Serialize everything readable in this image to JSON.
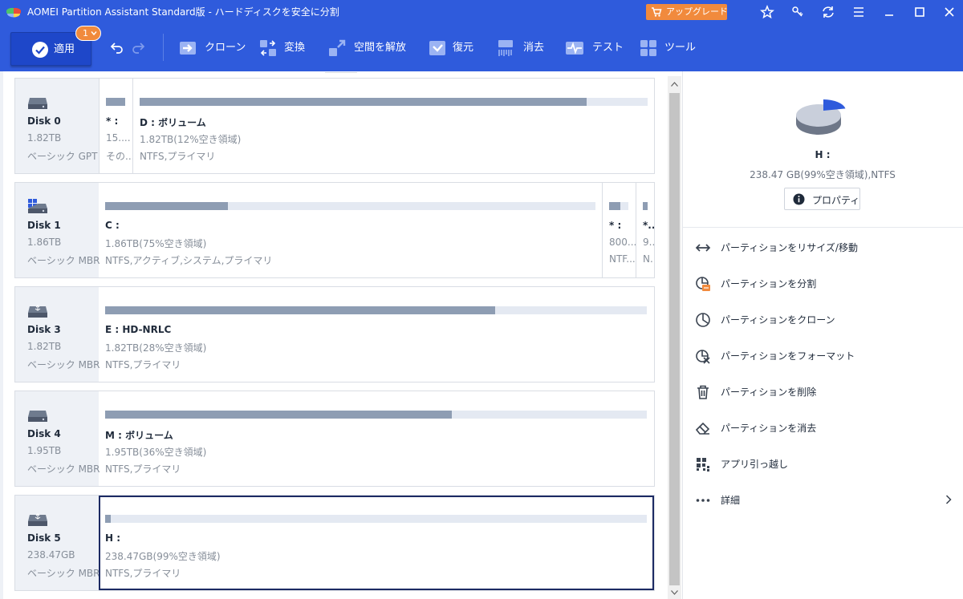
{
  "app": {
    "title": "AOMEI Partition Assistant Standard版 - ハードディスクを安全に分割",
    "upgrade_label": "アップグレード"
  },
  "titlebar_icons": [
    "star-icon",
    "key-icon",
    "refresh-icon",
    "menu-icon",
    "minimize-icon",
    "maximize-icon",
    "close-icon"
  ],
  "toolbar": {
    "apply_label": "適用",
    "pending_count": "1",
    "tools": [
      {
        "label": "クローン",
        "icon": "clone-icon"
      },
      {
        "label": "変換",
        "icon": "convert-icon"
      },
      {
        "label": "空間を解放",
        "icon": "free-space-icon"
      },
      {
        "label": "復元",
        "icon": "recovery-icon"
      },
      {
        "label": "消去",
        "icon": "wipe-icon"
      },
      {
        "label": "テスト",
        "icon": "test-icon"
      },
      {
        "label": "ツール",
        "icon": "tools-icon"
      }
    ]
  },
  "disks": [
    {
      "name": "Disk 0",
      "size": "1.82TB",
      "type": "ベーシック GPT",
      "icon": "hdd-icon",
      "partitions": [
        {
          "name": "* :",
          "size": "15....",
          "fs": "その...",
          "used_fraction": 1.0
        },
        {
          "name": "D : ボリューム",
          "size": "1.82TB(12%空き領域)",
          "fs": "NTFS,プライマリ",
          "used_fraction": 0.88
        }
      ]
    },
    {
      "name": "Disk 1",
      "size": "1.86TB",
      "type": "ベーシック MBR",
      "icon": "windows-disk-icon",
      "partitions": [
        {
          "name": "C :",
          "size": "1.86TB(75%空き領域)",
          "fs": "NTFS,アクティブ,システム,プライマリ",
          "used_fraction": 0.25
        },
        {
          "name": "* :",
          "size": "800...",
          "fs": "NTF...",
          "used_fraction": 0.6
        },
        {
          "name": "*...",
          "size": "9...",
          "fs": "N...",
          "used_fraction": 1.0
        }
      ]
    },
    {
      "name": "Disk 3",
      "size": "1.82TB",
      "type": "ベーシック MBR",
      "icon": "usb-disk-icon",
      "partitions": [
        {
          "name": "E : HD-NRLC",
          "size": "1.82TB(28%空き領域)",
          "fs": "NTFS,プライマリ",
          "used_fraction": 0.72
        }
      ]
    },
    {
      "name": "Disk 4",
      "size": "1.95TB",
      "type": "ベーシック MBR",
      "icon": "hdd-icon",
      "partitions": [
        {
          "name": "M : ボリューム",
          "size": "1.95TB(36%空き領域)",
          "fs": "NTFS,プライマリ",
          "used_fraction": 0.64
        }
      ]
    },
    {
      "name": "Disk 5",
      "size": "238.47GB",
      "type": "ベーシック MBR",
      "icon": "usb-disk-icon",
      "partitions": [
        {
          "name": "H :",
          "size": "238.47GB(99%空き領域)",
          "fs": "NTFS,プライマリ",
          "used_fraction": 0.01,
          "selected": true
        }
      ]
    }
  ],
  "selected": {
    "name": "H :",
    "info": "238.47 GB(99%空き領域),NTFS",
    "properties_label": "プロパティ",
    "used_fraction": 0.01
  },
  "operations": [
    {
      "label": "パーティションをリサイズ/移動",
      "icon": "resize-icon"
    },
    {
      "label": "パーティションを分割",
      "icon": "split-partition-icon"
    },
    {
      "label": "パーティションをクローン",
      "icon": "clone-partition-icon"
    },
    {
      "label": "パーティションをフォーマット",
      "icon": "format-icon"
    },
    {
      "label": "パーティションを削除",
      "icon": "delete-icon"
    },
    {
      "label": "パーティションを消去",
      "icon": "eraser-icon"
    },
    {
      "label": "アプリ引っ越し",
      "icon": "app-mover-icon"
    },
    {
      "label": "詳細",
      "icon": "more-icon",
      "has_submenu": true
    }
  ],
  "colors": {
    "brand_blue": "#2f5bdc",
    "accent_orange": "#f18a3d",
    "used_bar": "#8e9db3",
    "free_bar": "#e4e9f2",
    "selection_border": "#1c2a63"
  }
}
